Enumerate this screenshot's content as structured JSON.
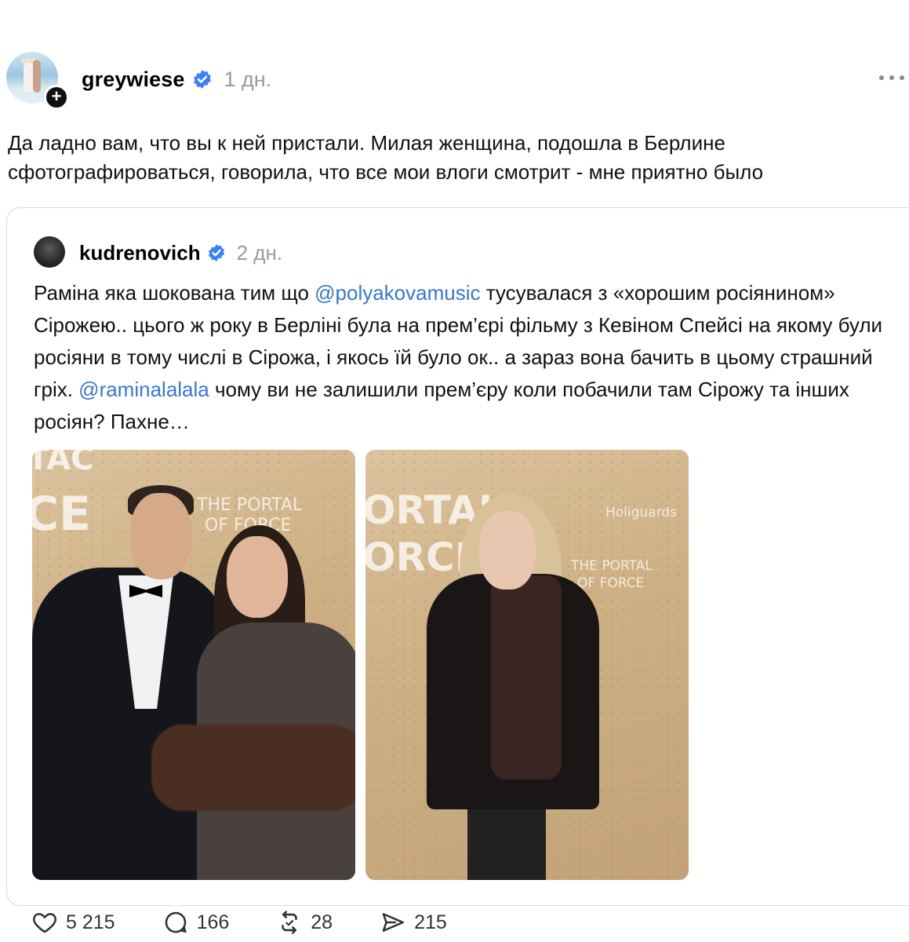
{
  "post": {
    "username": "greywiese",
    "time": "1 дн.",
    "text": "Да ладно вам, что вы к ней пристали. Милая женщина, подошла в Берлине сфотографироваться, говорила, что все мои влоги смотрит - мне приятно было"
  },
  "quoted": {
    "username": "kudrenovich",
    "time": "2 дн.",
    "text_1": "Раміна яка шокована тим що ",
    "mention_1": "@polyakovamusic",
    "text_2": " тусувалася з «хорошим росіянином» Сірожею.. цього ж року в Берліні була на прем’єрі фільму з Кевіном Спейсі на якому були росіяни в тому числі в Сірожа, і якось їй було ок.. а зараз вона бачить в цьому страшний гріх. ",
    "mention_2": "@raminalalala",
    "text_3": " чому ви не залишили прем’єру коли побачили там Сірожу та інших росіян? Пахне…",
    "photo_1": {
      "backdrop_1": "TAC",
      "backdrop_2": "CE",
      "backdrop_3": "THE PORTAL",
      "backdrop_4": "OF FORCE"
    },
    "photo_2": {
      "backdrop_1": "ORTAL",
      "backdrop_2": "ORCE",
      "backdrop_3": "Holiguards",
      "backdrop_4": "THE PORTAL",
      "backdrop_5": "OF FORCE"
    }
  },
  "actions": {
    "likes": "5 215",
    "comments": "166",
    "reposts": "28",
    "shares": "215"
  },
  "colors": {
    "verified": "#3b82f6",
    "mention": "#3a77c9",
    "muted": "#9a9a9a"
  },
  "icons": [
    "plus-icon",
    "verified-icon",
    "more-icon",
    "heart-icon",
    "comment-icon",
    "repost-icon",
    "share-icon"
  ]
}
